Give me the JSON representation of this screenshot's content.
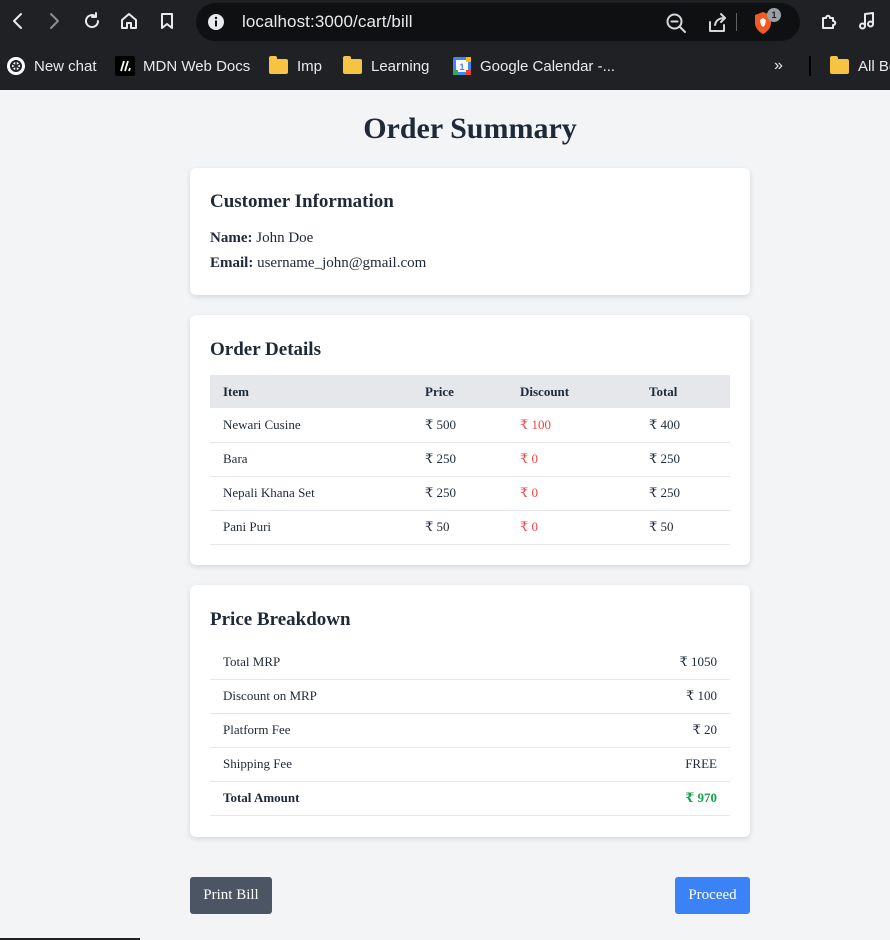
{
  "browser": {
    "url": "localhost:3000/cart/bill",
    "extension_badge": "1",
    "bookmarks": [
      {
        "label": "New chat",
        "icon": "openai-icon"
      },
      {
        "label": "MDN Web Docs",
        "icon": "mdn-icon"
      },
      {
        "label": "Imp",
        "icon": "folder-icon"
      },
      {
        "label": "Learning",
        "icon": "folder-icon"
      },
      {
        "label": "Google Calendar -...",
        "icon": "google-calendar-icon"
      },
      {
        "label": "All Bo",
        "icon": "folder-icon"
      }
    ],
    "overflow_label": "»"
  },
  "page": {
    "title": "Order Summary"
  },
  "customer": {
    "heading": "Customer Information",
    "name_label": "Name:",
    "name": "John Doe",
    "email_label": "Email:",
    "email": "username_john@gmail.com"
  },
  "order": {
    "heading": "Order Details",
    "columns": [
      "Item",
      "Price",
      "Discount",
      "Total"
    ],
    "rows": [
      {
        "item": "Newari Cusine",
        "price": "₹ 500",
        "discount": "₹ 100",
        "total": "₹ 400"
      },
      {
        "item": "Bara",
        "price": "₹ 250",
        "discount": "₹ 0",
        "total": "₹ 250"
      },
      {
        "item": "Nepali Khana Set",
        "price": "₹ 250",
        "discount": "₹ 0",
        "total": "₹ 250"
      },
      {
        "item": "Pani Puri",
        "price": "₹ 50",
        "discount": "₹ 0",
        "total": "₹ 50"
      }
    ]
  },
  "breakdown": {
    "heading": "Price Breakdown",
    "rows": [
      {
        "label": "Total MRP",
        "value": "₹ 1050"
      },
      {
        "label": "Discount on MRP",
        "value": "₹ 100"
      },
      {
        "label": "Platform Fee",
        "value": "₹ 20"
      },
      {
        "label": "Shipping Fee",
        "value": "FREE"
      },
      {
        "label": "Total Amount",
        "value": "₹ 970"
      }
    ]
  },
  "actions": {
    "print_label": "Print Bill",
    "proceed_label": "Proceed"
  },
  "colors": {
    "discount": "#ef4444",
    "total_amount": "#16a34a",
    "print_button": "#4b5563",
    "proceed_button": "#3b82f6"
  }
}
